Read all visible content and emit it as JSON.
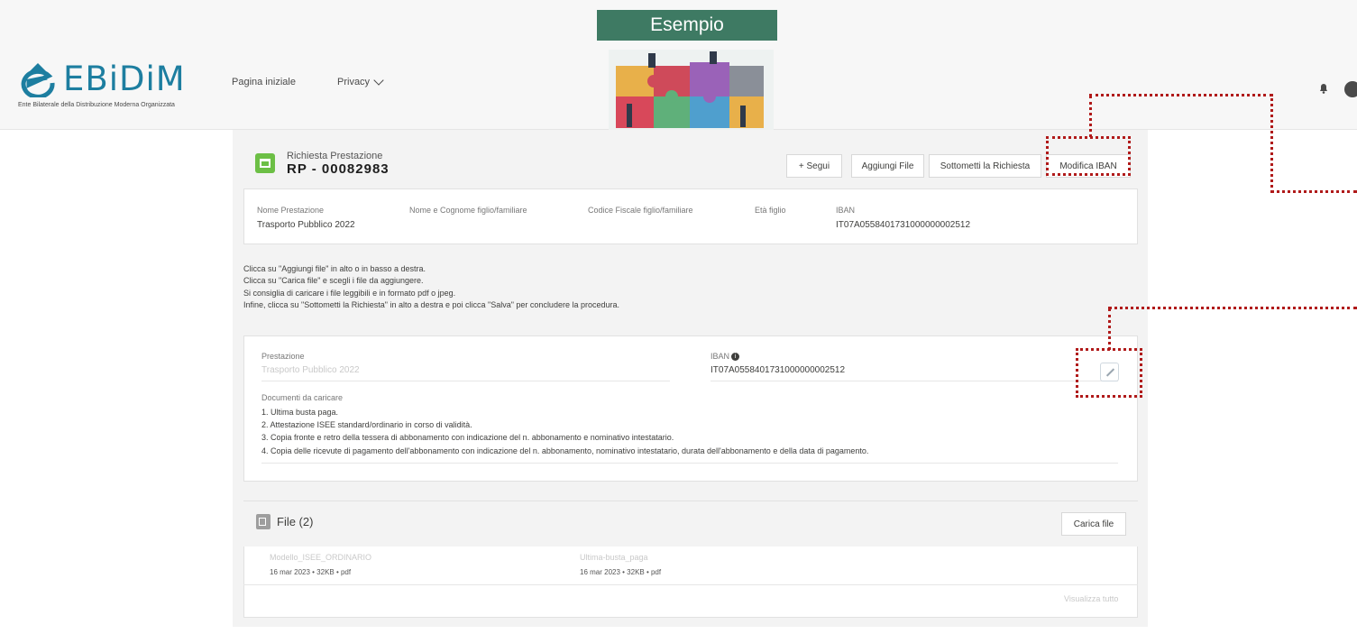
{
  "banner": {
    "label": "Esempio"
  },
  "logo": {
    "text": "EBiDiM",
    "tagline": "Ente Bilaterale della Distribuzione Moderna Organizzata"
  },
  "nav": {
    "home": "Pagina iniziale",
    "privacy": "Privacy"
  },
  "record": {
    "subtitle": "Richiesta Prestazione",
    "title": "RP - 00082983",
    "buttons": {
      "follow": "+ Segui",
      "add_file": "Aggiungi File",
      "submit": "Sottometti la Richiesta",
      "edit_iban": "Modifica IBAN"
    }
  },
  "summary": {
    "service_label": "Nome Prestazione",
    "service_value": "Trasporto Pubblico 2022",
    "child_name_label": "Nome e Cognome figlio/familiare",
    "tax_code_label": "Codice Fiscale figlio/familiare",
    "child_age_label": "Età figlio",
    "iban_label": "IBAN",
    "iban_value": "IT07A0558401731000000002512"
  },
  "instructions": [
    "Clicca su \"Aggiungi file\" in alto o in basso a destra.",
    "Clicca su \"Carica file\" e scegli i file da aggiungere.",
    "Si consiglia di caricare i file leggibili e in formato pdf o jpeg.",
    "Infine, clicca su \"Sottometti la Richiesta\" in alto a destra e poi clicca \"Salva\" per concludere la procedura."
  ],
  "detail": {
    "service_label": "Prestazione",
    "service_value": "Trasporto Pubblico 2022",
    "iban_label": "IBAN",
    "iban_value": "IT07A0558401731000000002512",
    "docs_label": "Documenti da caricare",
    "docs": [
      "1. Ultima busta paga.",
      "2. Attestazione ISEE standard/ordinario in corso di validità.",
      "3. Copia fronte e retro della tessera di abbonamento con indicazione del n. abbonamento e nominativo intestatario.",
      "4. Copia delle ricevute di pagamento dell'abbonamento con indicazione del n. abbonamento, nominativo intestatario, durata dell'abbonamento e della data di pagamento."
    ]
  },
  "files": {
    "title": "File (2)",
    "upload_label": "Carica file",
    "view_all": "Visualizza tutto",
    "items": [
      {
        "name": "Modello_ISEE_ORDINARIO",
        "meta": "16 mar 2023 • 32KB • pdf"
      },
      {
        "name": "Ultima-busta_paga",
        "meta": "16 mar 2023 • 32KB • pdf"
      }
    ]
  },
  "colors": {
    "banner": "#3e7a63",
    "record_icon": "#6cbf45",
    "annotation": "#b01a1a",
    "logo": "#1d7ea0"
  },
  "icons": [
    "bell-icon",
    "user-icon",
    "chevron-down-icon",
    "edit-icon",
    "file-icon",
    "record-icon",
    "info-icon"
  ]
}
